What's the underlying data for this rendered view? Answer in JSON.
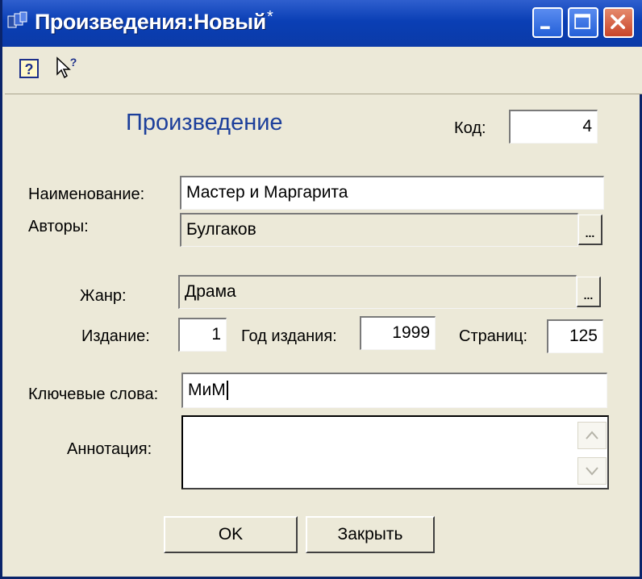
{
  "window": {
    "title": "Произведения:Новый",
    "modified_mark": "*"
  },
  "form": {
    "heading": "Произведение",
    "code": {
      "label": "Код:",
      "value": "4"
    },
    "name": {
      "label": "Наименование:",
      "value": "Мастер и Маргарита"
    },
    "authors": {
      "label": "Авторы:",
      "value": "Булгаков",
      "select_label": "..."
    },
    "genre": {
      "label": "Жанр:",
      "value": "Драма",
      "select_label": "..."
    },
    "edition": {
      "label": "Издание:",
      "value": "1"
    },
    "year": {
      "label": "Год издания:",
      "value": "1999"
    },
    "pages": {
      "label": "Страниц:",
      "value": "125"
    },
    "keywords": {
      "label": "Ключевые слова:",
      "value": "МиМ"
    },
    "annotation": {
      "label": "Аннотация:",
      "value": ""
    }
  },
  "buttons": {
    "ok": "OK",
    "close": "Закрыть"
  },
  "icons": [
    "app-icon",
    "help-icon",
    "whats-this-icon",
    "minimize-icon",
    "maximize-icon",
    "close-icon",
    "scroll-up-icon",
    "scroll-down-icon"
  ]
}
